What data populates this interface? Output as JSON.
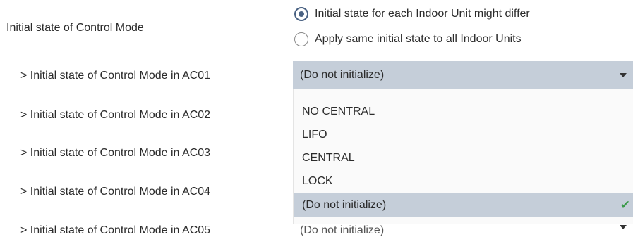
{
  "control_mode": {
    "label": "Initial state of Control Mode",
    "options": [
      {
        "label": "Initial state for each Indoor Unit might differ",
        "checked": true
      },
      {
        "label": "Apply same initial state to all Indoor Units",
        "checked": false
      }
    ]
  },
  "units": [
    {
      "label": "> Initial state of Control Mode in AC01",
      "value": "(Do not initialize)"
    },
    {
      "label": "> Initial state of Control Mode in AC02"
    },
    {
      "label": "> Initial state of Control Mode in AC03"
    },
    {
      "label": "> Initial state of Control Mode in AC04"
    },
    {
      "label": "> Initial state of Control Mode in AC05",
      "value": "(Do not initialize)"
    }
  ],
  "dropdown": {
    "options": [
      "NO CENTRAL",
      "LIFO",
      "CENTRAL",
      "LOCK",
      "(Do not initialize)"
    ],
    "selected": "(Do not initialize)"
  },
  "icons": {
    "caret": "chevron-down-icon",
    "check": "checkmark-icon"
  },
  "colors": {
    "highlight": "#c5ced9",
    "radio_accent": "#4a6283",
    "check_green": "#3a9a48"
  }
}
